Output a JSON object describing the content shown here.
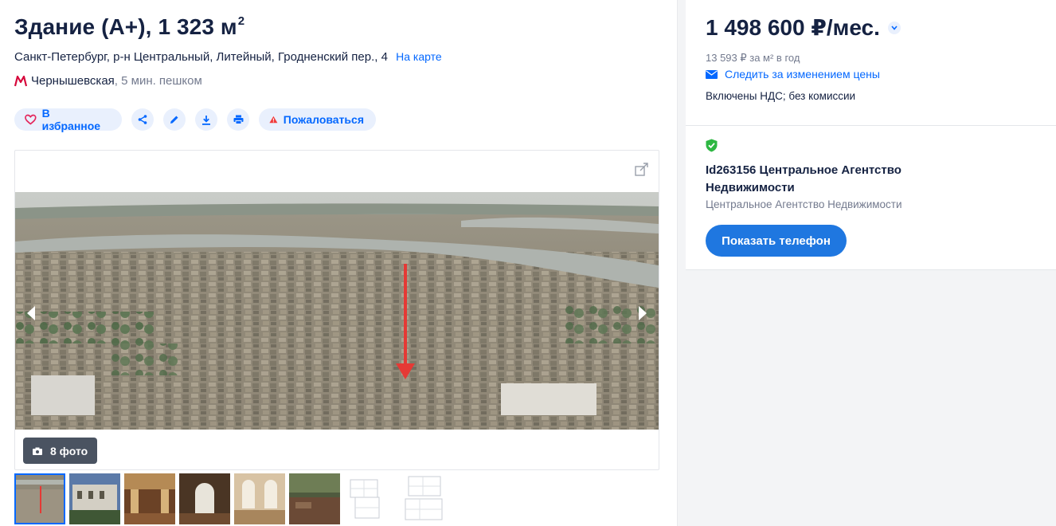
{
  "listing": {
    "title": "Здание (А+), 1 323 м",
    "title_sup": "2",
    "address": "Санкт-Петербург, р-н Центральный, Литейный, Гродненский пер., 4",
    "map_link": "На карте",
    "metro": {
      "station": "Чернышевская",
      "walk": ", 5 мин. пешком",
      "line_color": "#d6083b"
    }
  },
  "actions": {
    "favorite": "В избранное",
    "complain": "Пожаловаться",
    "icons": [
      "heart-icon",
      "share-icon",
      "edit-icon",
      "download-icon",
      "print-icon",
      "warning-icon"
    ]
  },
  "gallery": {
    "photo_count": "8 фото",
    "thumbnails": [
      {
        "name": "aerial",
        "active": true
      },
      {
        "name": "facade",
        "active": false
      },
      {
        "name": "hall",
        "active": false
      },
      {
        "name": "arched-window",
        "active": false
      },
      {
        "name": "interior",
        "active": false
      },
      {
        "name": "courtyard",
        "active": false
      },
      {
        "name": "floor-plan-1",
        "active": false
      },
      {
        "name": "floor-plan-2",
        "active": false
      }
    ]
  },
  "pricing": {
    "price": "1 498 600 ₽/мес.",
    "per_meter": "13 593 ₽ за м² в год",
    "track_link": "Следить за изменением цены",
    "terms": "Включены НДС; без комиссии"
  },
  "agent": {
    "name": "Id263156 Центральное Агентство Недвижимости",
    "company": "Центральное Агентство Недвижимости",
    "phone_button": "Показать телефон",
    "verified_color": "#2db742"
  },
  "colors": {
    "accent": "#0468ff",
    "text": "#152242",
    "muted": "#737a8e"
  }
}
